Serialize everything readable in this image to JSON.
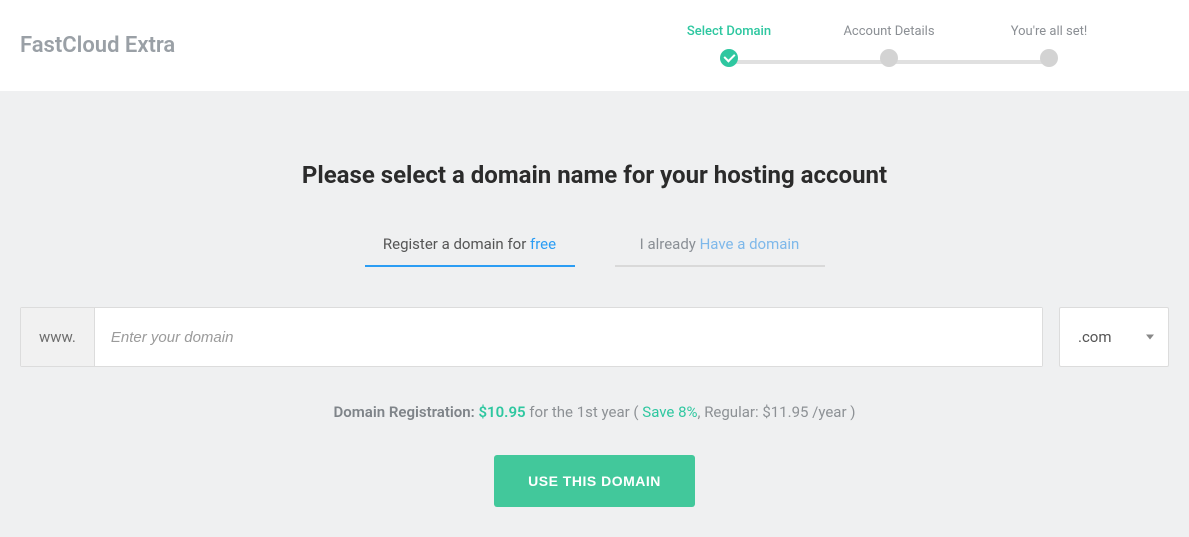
{
  "header": {
    "brand": "FastCloud Extra",
    "steps": [
      {
        "label": "Select Domain",
        "active": true
      },
      {
        "label": "Account Details",
        "active": false
      },
      {
        "label": "You're all set!",
        "active": false
      }
    ]
  },
  "main": {
    "title": "Please select a domain name for your hosting account",
    "tabs": {
      "register": {
        "prefix": "Register a domain for ",
        "accent": "free"
      },
      "have": {
        "prefix": "I already ",
        "accent": "Have a domain"
      }
    },
    "domain": {
      "prefix": "www.",
      "placeholder": "Enter your domain",
      "tld": ".com"
    },
    "pricing": {
      "label": "Domain Registration: ",
      "price": "$10.95",
      "mid1": " for the 1st year ( ",
      "save": "Save 8%",
      "mid2": ", Regular: $11.95 /year )"
    },
    "cta": "USE THIS DOMAIN"
  }
}
